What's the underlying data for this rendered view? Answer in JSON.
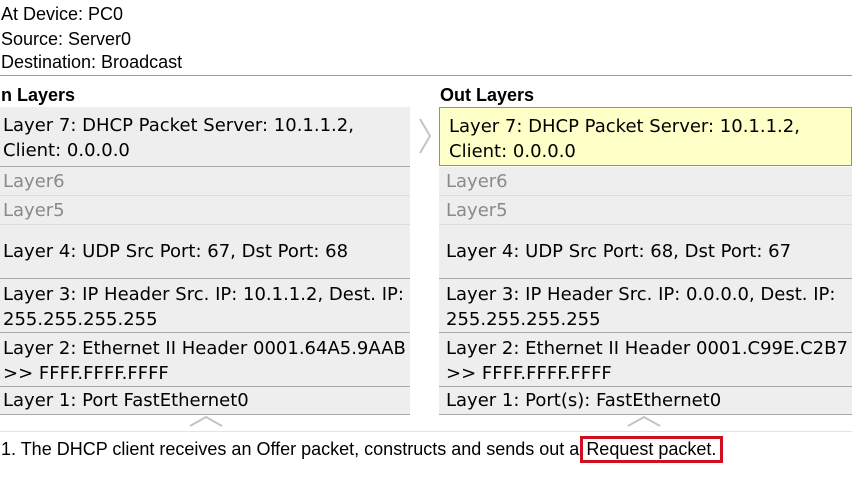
{
  "header": {
    "device": "At Device: PC0",
    "source": "Source: Server0",
    "destination": "Destination: Broadcast"
  },
  "in_layers": {
    "title": "n Layers",
    "layers": [
      "Layer 7: DHCP Packet Server: 10.1.1.2, Client: 0.0.0.0",
      "Layer6",
      "Layer5",
      "Layer 4: UDP Src Port: 67, Dst Port: 68",
      "Layer 3: IP Header Src. IP: 10.1.1.2, Dest. IP: 255.255.255.255",
      "Layer 2: Ethernet II Header 0001.64A5.9AAB >> FFFF.FFFF.FFFF",
      "Layer 1: Port FastEthernet0"
    ]
  },
  "out_layers": {
    "title": "Out Layers",
    "layers": [
      "Layer 7: DHCP Packet Server: 10.1.1.2, Client: 0.0.0.0",
      "Layer6",
      "Layer5",
      "Layer 4: UDP Src Port: 68, Dst Port: 67",
      "Layer 3: IP Header Src. IP: 0.0.0.0, Dest. IP: 255.255.255.255",
      "Layer 2: Ethernet II Header 0001.C99E.C2B7 >> FFFF.FFFF.FFFF",
      "Layer 1: Port(s): FastEthernet0"
    ]
  },
  "description": {
    "text": "1. The DHCP client receives an Offer packet, constructs and sends out a",
    "highlighted": "Request packet."
  },
  "colors": {
    "selected_layer_bg": "#ffffc8",
    "highlight_border": "#d01020"
  },
  "icons": {
    "transfer_arrow": "chevron-right-icon",
    "scroll_up": "chevron-up-icon"
  }
}
